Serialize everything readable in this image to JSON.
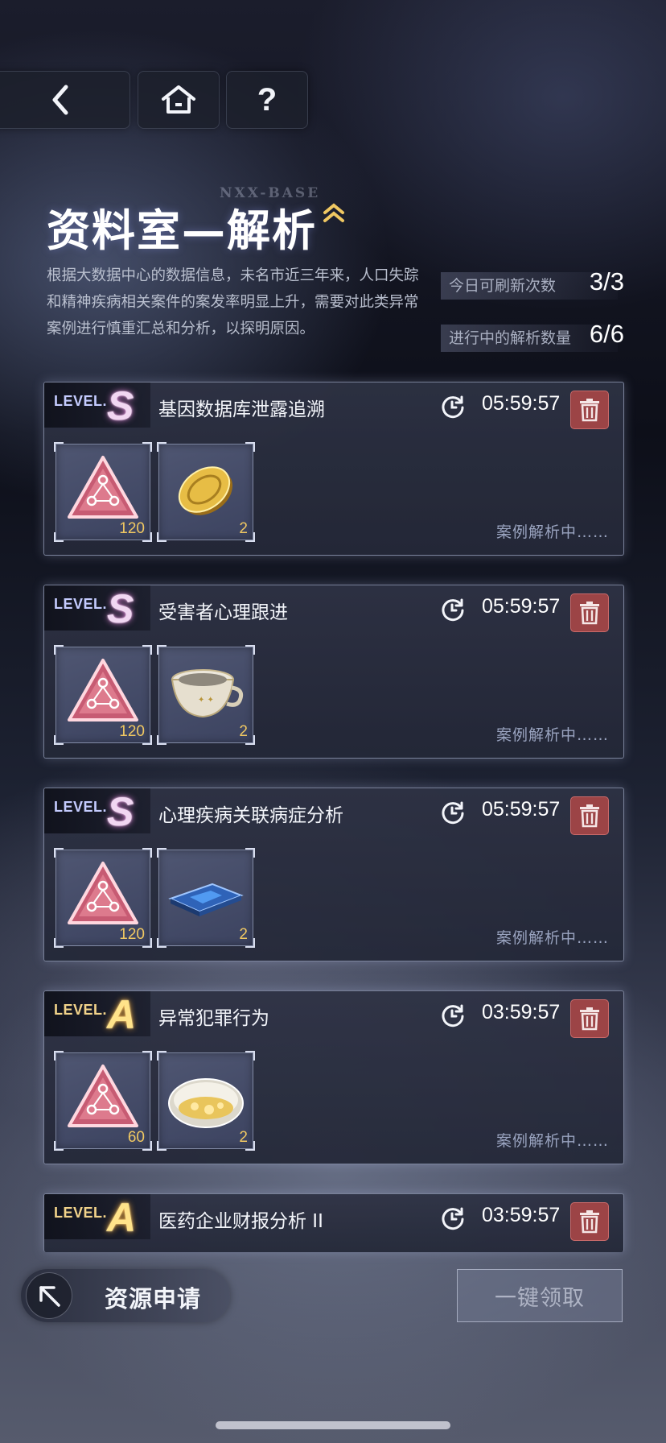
{
  "nav": {
    "back_icon": "chevron-left-icon",
    "home_icon": "home-icon",
    "help_label": "?"
  },
  "header": {
    "watermark": "NXX-BASE",
    "title": "资料室—解析",
    "description": "根据大数据中心的数据信息，未名市近三年来，人口失踪和精神疾病相关案件的案发率明显上升，需要对此类异常案例进行慎重汇总和分析，以探明原因。"
  },
  "stats": [
    {
      "label": "今日可刷新次数",
      "value": "3/3"
    },
    {
      "label": "进行中的解析数量",
      "value": "6/6"
    }
  ],
  "level_prefix": "LEVEL.",
  "cases": [
    {
      "grade": "S",
      "title": "基因数据库泄露追溯",
      "timer": "05:59:57",
      "status": "案例解析中……",
      "items": [
        {
          "icon": "triangle-chip-icon",
          "qty": "120"
        },
        {
          "icon": "gold-coin-icon",
          "qty": "2"
        }
      ]
    },
    {
      "grade": "S",
      "title": "受害者心理跟进",
      "timer": "05:59:57",
      "status": "案例解析中……",
      "items": [
        {
          "icon": "triangle-chip-icon",
          "qty": "120"
        },
        {
          "icon": "teacup-icon",
          "qty": "2"
        }
      ]
    },
    {
      "grade": "S",
      "title": "心理疾病关联病症分析",
      "timer": "05:59:57",
      "status": "案例解析中……",
      "items": [
        {
          "icon": "triangle-chip-icon",
          "qty": "120"
        },
        {
          "icon": "blue-chip-board-icon",
          "qty": "2"
        }
      ]
    },
    {
      "grade": "A",
      "title": "异常犯罪行为",
      "timer": "03:59:57",
      "status": "案例解析中……",
      "items": [
        {
          "icon": "triangle-chip-icon",
          "qty": "60"
        },
        {
          "icon": "glass-dish-icon",
          "qty": "2"
        }
      ]
    },
    {
      "grade": "A",
      "title": "医药企业财报分析 II",
      "timer": "03:59:57"
    }
  ],
  "bottom": {
    "resource_label": "资源申请",
    "claim_label": "一键领取"
  },
  "colors": {
    "grade_s_glow": "#f08ce6",
    "grade_a": "#ffe38a",
    "delete_button": "#9c4446",
    "quantity": "#f0c862"
  }
}
